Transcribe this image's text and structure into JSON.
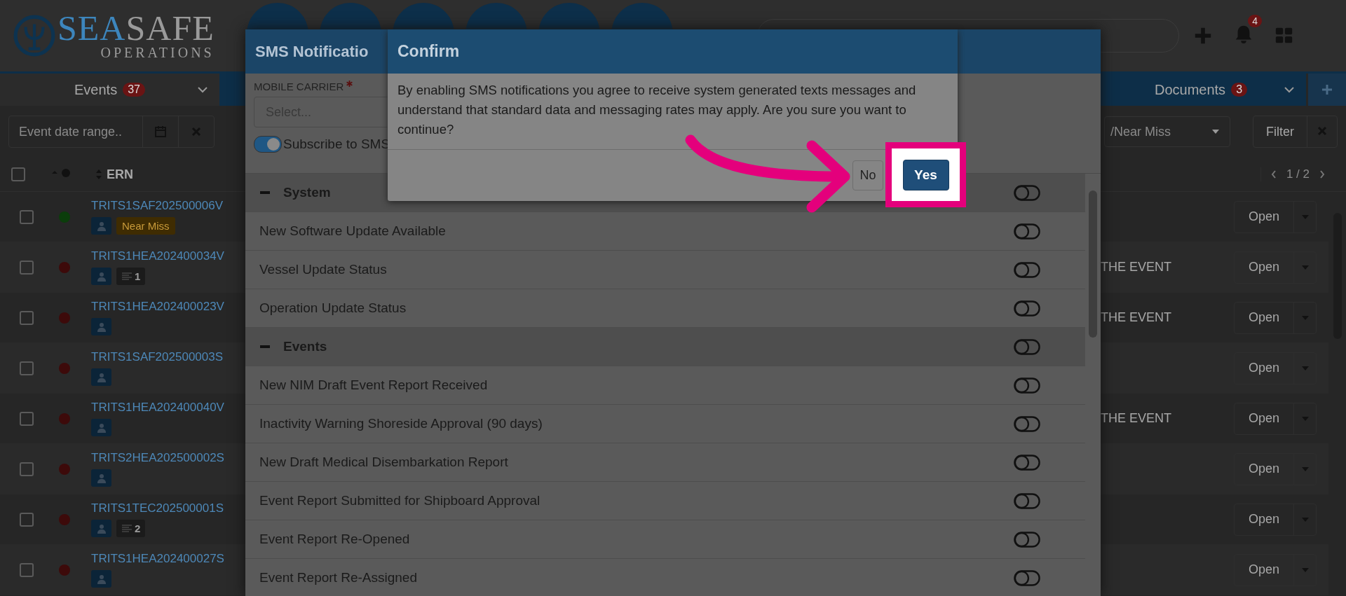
{
  "header": {
    "logo": {
      "first": "SEA",
      "second": "SAFE",
      "sub": "OPERATIONS"
    },
    "notifications": "4"
  },
  "tabs": [
    {
      "label": "Events",
      "count": "37",
      "selected": true
    },
    {
      "label": "Documents",
      "count": "3",
      "selected": false
    }
  ],
  "filters": {
    "date_range": {
      "placeholder": "Event date range.."
    },
    "type_select": {
      "value": "/Near Miss"
    },
    "filter_button": "Filter"
  },
  "table": {
    "columns": [
      "ERN"
    ],
    "select_all_checked": false,
    "pagination": "1 / 2",
    "rows": [
      {
        "ern": "TRITS1SAF202500006V",
        "color": "#0b3d0b",
        "tags": [
          {
            "kind": "person"
          },
          {
            "kind": "label",
            "label": "Near Miss"
          }
        ],
        "action": "Open",
        "checked": false
      },
      {
        "ern": "TRITS1HEA202400034V",
        "color": "#3d0a0a",
        "tags": [
          {
            "kind": "person"
          },
          {
            "kind": "count",
            "label": "1"
          }
        ],
        "column_3": "THE EVENT",
        "action": "Open",
        "checked": false
      },
      {
        "ern": "TRITS1HEA202400023V",
        "color": "#3d0a0a",
        "tags": [
          {
            "kind": "person"
          }
        ],
        "column_3": "THE EVENT",
        "action": "Open",
        "checked": false
      },
      {
        "ern": "TRITS1SAF202500003S",
        "color": "#3d0a0a",
        "tags": [
          {
            "kind": "person"
          }
        ],
        "action": "Open",
        "checked": false
      },
      {
        "ern": "TRITS1HEA202400040V",
        "color": "#3d0a0a",
        "tags": [
          {
            "kind": "person"
          }
        ],
        "column_3": "THE EVENT",
        "action": "Open",
        "checked": false
      },
      {
        "ern": "TRITS2HEA202500002S",
        "color": "#3d0a0a",
        "tags": [
          {
            "kind": "person"
          }
        ],
        "action": "Open",
        "checked": false
      },
      {
        "ern": "TRITS1TEC202500001S",
        "color": "#3d0a0a",
        "tags": [
          {
            "kind": "person"
          },
          {
            "kind": "count",
            "label": "2"
          }
        ],
        "action": "Open",
        "checked": false
      },
      {
        "ern": "TRITS1HEA202400027S",
        "color": "#3d0a0a",
        "tags": [
          {
            "kind": "person"
          }
        ],
        "action": "Open",
        "checked": false
      }
    ]
  },
  "sms_modal": {
    "title": "SMS Notificatio",
    "carrier_label": "MOBILE CARRIER",
    "required": true,
    "carrier_placeholder": "Select...",
    "subscribe": {
      "label": "Subscribe to SMS",
      "on": true
    },
    "sections": [
      {
        "title": "System",
        "expanded": true,
        "on": false,
        "items": [
          {
            "label": "New Software Update Available",
            "on": false
          },
          {
            "label": "Vessel Update Status",
            "on": false
          },
          {
            "label": "Operation Update Status",
            "on": false
          }
        ]
      },
      {
        "title": "Events",
        "expanded": true,
        "on": false,
        "items": [
          {
            "label": "New NIM Draft Event Report Received",
            "on": false
          },
          {
            "label": "Inactivity Warning Shoreside Approval (90 days)",
            "on": false
          },
          {
            "label": "New Draft Medical Disembarkation Report",
            "on": false
          },
          {
            "label": "Event Report Submitted for Shipboard Approval",
            "on": false
          },
          {
            "label": "Event Report Re-Opened",
            "on": false
          },
          {
            "label": "Event Report Re-Assigned",
            "on": false
          }
        ]
      }
    ]
  },
  "confirm": {
    "title": "Confirm",
    "message": "By enabling SMS notifications you agree to receive system generated texts messages and understand that standard data and messaging rates may apply. Are you sure you want to continue?",
    "buttons": [
      "No",
      "Yes"
    ]
  }
}
